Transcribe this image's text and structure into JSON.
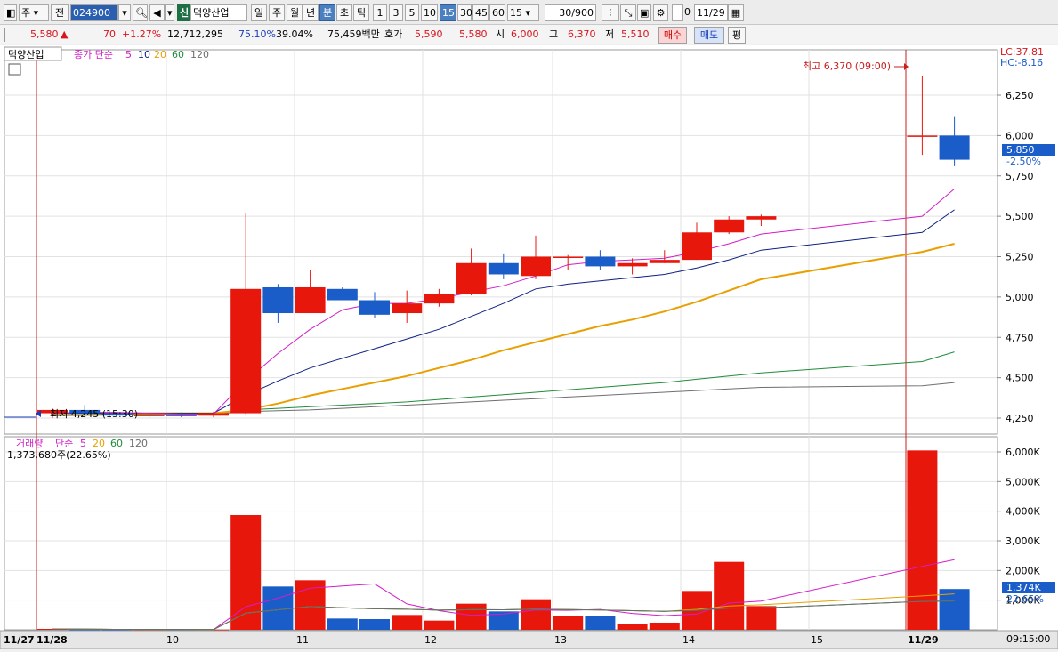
{
  "toolbar": {
    "mode": "주",
    "full_label": "전",
    "code": "024900",
    "shin_badge": "신",
    "stock_name": "덕양산업",
    "periods": [
      "일",
      "주",
      "월",
      "년",
      "분",
      "초",
      "틱"
    ],
    "active_period": "분",
    "intervals": [
      "1",
      "3",
      "5",
      "10",
      "15",
      "30",
      "45",
      "60"
    ],
    "active_interval": "15",
    "interval_select": "15",
    "count": "30/900",
    "checkbox_value": "0",
    "date": "11/29"
  },
  "quote": {
    "price": "5,580",
    "arrow": "▲",
    "change": "70",
    "change_pct": "+1.27%",
    "volume": "12,712,295",
    "vol_ratio": "75.10%",
    "turnover_ratio": "39.04%",
    "amount": "75,459백만",
    "hoga_label": "호가",
    "ask": "5,590",
    "bid": "5,580",
    "open_label": "시",
    "open": "6,000",
    "high_label": "고",
    "high": "6,370",
    "low_label": "저",
    "low": "5,510",
    "buy_label": "매수",
    "sell_label": "매도",
    "pyeong_label": "평"
  },
  "price_panel": {
    "stock_tag": "덕양산업",
    "legend_prefix": "종가 단순",
    "ma_periods": [
      "5",
      "10",
      "20",
      "60",
      "120"
    ],
    "ma_colors": [
      "#d21ec8",
      "#0f2080",
      "#e8a000",
      "#1f8c3a",
      "#6e6e6e"
    ],
    "lc_label": "LC:37.81",
    "hc_label": "HC:-8.16",
    "high_annotation": "최고 6,370 (09:00)",
    "low_annotation": "최저 4,245 (15:30)",
    "current_price_tag": "5,850",
    "current_pct_tag": "-2.50%",
    "y_ticks": [
      "6,250",
      "6,000",
      "5,750",
      "5,500",
      "5,250",
      "5,000",
      "4,750",
      "4,500",
      "4,250"
    ]
  },
  "volume_panel": {
    "title": "거래량",
    "legend_prefix": "단순",
    "ma_periods": [
      "5",
      "20",
      "60",
      "120"
    ],
    "current_value": "1,373,680주(22.65%)",
    "value_tag": "1,374K",
    "pct_tag": "22.65%",
    "y_ticks": [
      "6,000K",
      "5,000K",
      "4,000K",
      "3,000K",
      "2,000K",
      "1,000K"
    ]
  },
  "x_axis": {
    "labels": [
      "11/27",
      "11/28",
      "10",
      "11",
      "12",
      "13",
      "14",
      "15",
      "11/29"
    ],
    "time_label": "09:15:00"
  },
  "colors": {
    "up": "#e8170c",
    "down": "#1a5cc8",
    "vline": "#c81e1e",
    "tag_bg": "#1a5cc8"
  },
  "chart_data": {
    "type": "candlestick",
    "ohlc": [
      {
        "o": 4280,
        "h": 4310,
        "l": 4250,
        "c": 4300
      },
      {
        "o": 4300,
        "h": 4330,
        "l": 4270,
        "c": 4280
      },
      {
        "o": 4280,
        "h": 4290,
        "l": 4260,
        "c": 4270
      },
      {
        "o": 4265,
        "h": 4275,
        "l": 4255,
        "c": 4270
      },
      {
        "o": 4270,
        "h": 4285,
        "l": 4255,
        "c": 4265
      },
      {
        "o": 4265,
        "h": 4290,
        "l": 4255,
        "c": 4280
      },
      {
        "o": 4280,
        "h": 5520,
        "l": 4275,
        "c": 5050
      },
      {
        "o": 5060,
        "h": 5080,
        "l": 4840,
        "c": 4900
      },
      {
        "o": 4900,
        "h": 5170,
        "l": 4900,
        "c": 5060
      },
      {
        "o": 5050,
        "h": 5060,
        "l": 4980,
        "c": 4980
      },
      {
        "o": 4980,
        "h": 5030,
        "l": 4870,
        "c": 4890
      },
      {
        "o": 4900,
        "h": 5040,
        "l": 4840,
        "c": 4960
      },
      {
        "o": 4960,
        "h": 5050,
        "l": 4940,
        "c": 5020
      },
      {
        "o": 5020,
        "h": 5300,
        "l": 5010,
        "c": 5210
      },
      {
        "o": 5210,
        "h": 5270,
        "l": 5110,
        "c": 5140
      },
      {
        "o": 5130,
        "h": 5380,
        "l": 5110,
        "c": 5250
      },
      {
        "o": 5250,
        "h": 5260,
        "l": 5170,
        "c": 5250
      },
      {
        "o": 5250,
        "h": 5290,
        "l": 5170,
        "c": 5190
      },
      {
        "o": 5190,
        "h": 5240,
        "l": 5140,
        "c": 5210
      },
      {
        "o": 5210,
        "h": 5290,
        "l": 5210,
        "c": 5230
      },
      {
        "o": 5230,
        "h": 5460,
        "l": 5230,
        "c": 5400
      },
      {
        "o": 5400,
        "h": 5500,
        "l": 5390,
        "c": 5480
      },
      {
        "o": 5480,
        "h": 5510,
        "l": 5440,
        "c": 5500
      },
      {
        "o": 6000,
        "h": 6370,
        "l": 5880,
        "c": 6000
      },
      {
        "o": 6000,
        "h": 6120,
        "l": 5810,
        "c": 5850
      }
    ],
    "x_index": [
      0,
      1,
      2,
      3,
      4,
      5,
      6,
      7,
      8,
      9,
      10,
      11,
      12,
      13,
      14,
      15,
      16,
      17,
      18,
      19,
      20,
      21,
      22,
      27,
      28
    ],
    "ma5": [
      4280,
      4285,
      4285,
      4280,
      4275,
      4275,
      4480,
      4650,
      4800,
      4920,
      4960,
      4960,
      4990,
      5030,
      5070,
      5130,
      5200,
      5220,
      5230,
      5240,
      5280,
      5330,
      5390,
      5500,
      5670
    ],
    "ma10": [
      4280,
      4280,
      4280,
      4280,
      4280,
      4280,
      4390,
      4480,
      4560,
      4620,
      4680,
      4740,
      4800,
      4880,
      4960,
      5050,
      5080,
      5100,
      5120,
      5140,
      5180,
      5230,
      5290,
      5400,
      5540
    ],
    "ma20": [
      4280,
      4280,
      4280,
      4280,
      4280,
      4280,
      4300,
      4340,
      4390,
      4430,
      4470,
      4510,
      4560,
      4610,
      4670,
      4720,
      4770,
      4820,
      4860,
      4910,
      4970,
      5040,
      5110,
      5280,
      5330
    ],
    "ma60": [
      4270,
      4270,
      4275,
      4275,
      4278,
      4280,
      4300,
      4310,
      4320,
      4330,
      4340,
      4350,
      4365,
      4380,
      4395,
      4410,
      4425,
      4440,
      4455,
      4470,
      4490,
      4510,
      4530,
      4600,
      4660
    ],
    "ma120": [
      4265,
      4267,
      4269,
      4270,
      4272,
      4274,
      4290,
      4295,
      4300,
      4310,
      4320,
      4330,
      4340,
      4350,
      4360,
      4370,
      4380,
      4390,
      4400,
      4410,
      4420,
      4430,
      4440,
      4450,
      4470
    ],
    "volume": [
      30,
      10,
      5,
      5,
      5,
      5,
      3870,
      1460,
      1670,
      380,
      360,
      500,
      310,
      880,
      620,
      1030,
      450,
      450,
      210,
      240,
      1310,
      2290,
      800,
      6050,
      1374
    ],
    "ylim_price": [
      4200,
      6400
    ],
    "ylim_volume": [
      0,
      6500
    ]
  }
}
